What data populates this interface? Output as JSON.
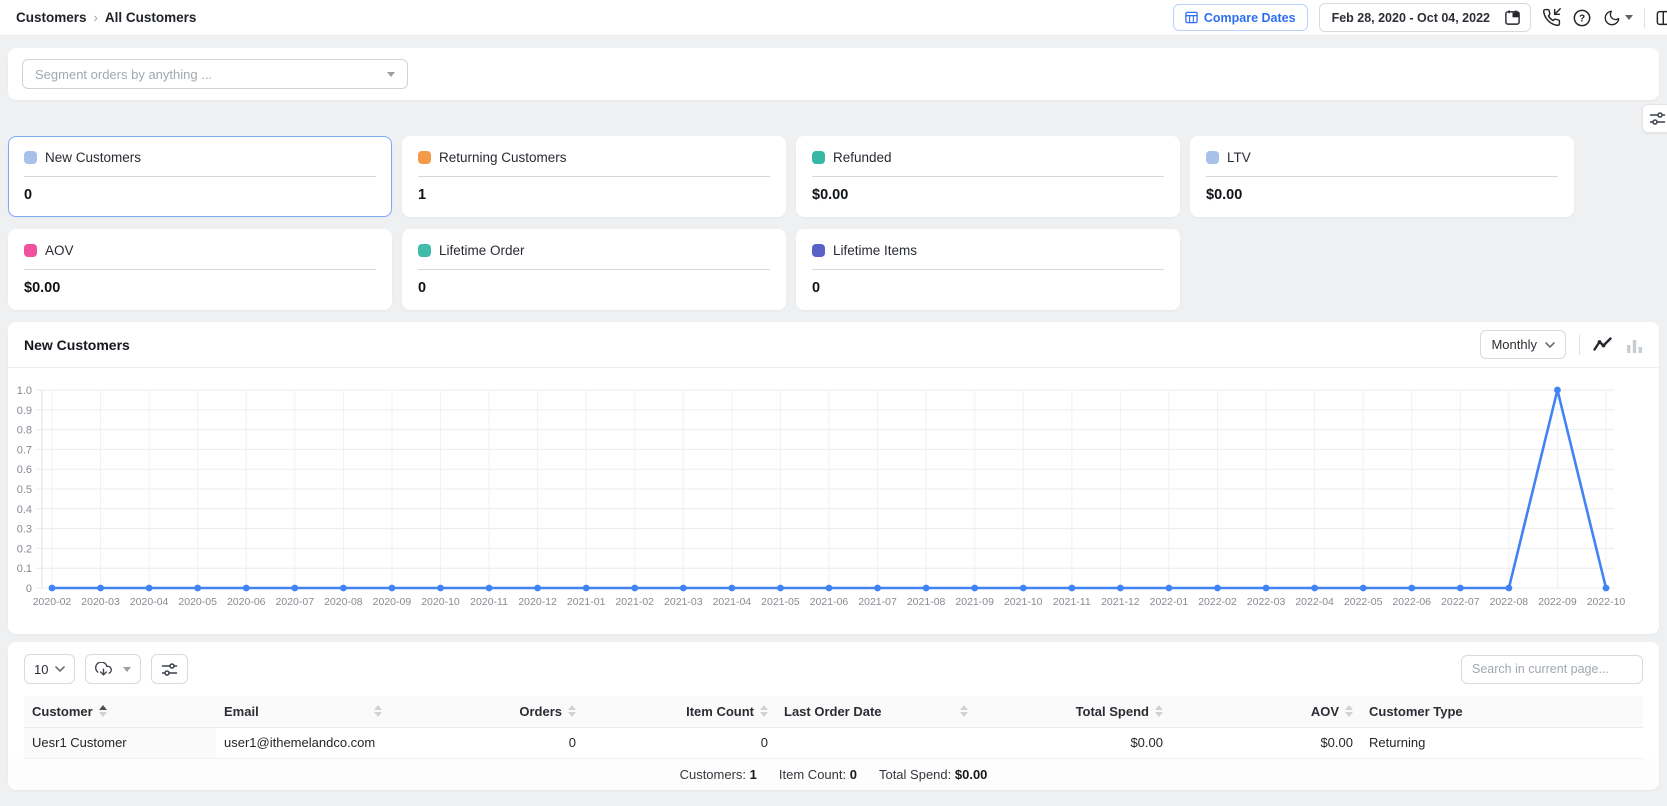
{
  "breadcrumb": {
    "items": [
      "Customers",
      "All Customers"
    ],
    "separator": "›"
  },
  "topbar": {
    "compare_dates_label": "Compare Dates",
    "date_range": "Feb 28, 2020 - Oct 04, 2022"
  },
  "segment": {
    "placeholder": "Segment orders by anything ..."
  },
  "stat_cards": [
    {
      "label": "New Customers",
      "value": "0",
      "color": "#a9c0ea",
      "selected": true
    },
    {
      "label": "Returning Customers",
      "value": "1",
      "color": "#f59a49",
      "selected": false
    },
    {
      "label": "Refunded",
      "value": "$0.00",
      "color": "#38b7a4",
      "selected": false
    },
    {
      "label": "LTV",
      "value": "$0.00",
      "color": "#a9c0ea",
      "selected": false
    },
    {
      "label": "AOV",
      "value": "$0.00",
      "color": "#f0509e",
      "selected": false
    },
    {
      "label": "Lifetime Order",
      "value": "0",
      "color": "#41bcab",
      "selected": false
    },
    {
      "label": "Lifetime Items",
      "value": "0",
      "color": "#5a61c9",
      "selected": false
    }
  ],
  "chart_section": {
    "title": "New Customers",
    "interval_selected": "Monthly"
  },
  "chart_data": {
    "type": "line",
    "title": "New Customers",
    "categories": [
      "2020-02",
      "2020-03",
      "2020-04",
      "2020-05",
      "2020-06",
      "2020-07",
      "2020-08",
      "2020-09",
      "2020-10",
      "2020-11",
      "2020-12",
      "2021-01",
      "2021-02",
      "2021-03",
      "2021-04",
      "2021-05",
      "2021-06",
      "2021-07",
      "2021-08",
      "2021-09",
      "2021-10",
      "2021-11",
      "2021-12",
      "2022-01",
      "2022-02",
      "2022-03",
      "2022-04",
      "2022-05",
      "2022-06",
      "2022-07",
      "2022-08",
      "2022-09",
      "2022-10"
    ],
    "values": [
      0,
      0,
      0,
      0,
      0,
      0,
      0,
      0,
      0,
      0,
      0,
      0,
      0,
      0,
      0,
      0,
      0,
      0,
      0,
      0,
      0,
      0,
      0,
      0,
      0,
      0,
      0,
      0,
      0,
      0,
      0,
      1,
      0
    ],
    "xlabel": "",
    "ylabel": "",
    "ylim": [
      0,
      1.0
    ],
    "yticks": [
      0,
      0.1,
      0.2,
      0.3,
      0.4,
      0.5,
      0.6,
      0.7,
      0.8,
      0.9,
      1.0
    ],
    "line_color": "#4183f4",
    "grid": true,
    "legend": false
  },
  "table": {
    "page_size": "10",
    "search_placeholder": "Search in current page...",
    "columns": [
      {
        "label": "Customer",
        "sort": "asc",
        "align": "left"
      },
      {
        "label": "Email",
        "sort": "none",
        "align": "left"
      },
      {
        "label": "Orders",
        "sort": "none",
        "align": "right"
      },
      {
        "label": "Item Count",
        "sort": "none",
        "align": "right"
      },
      {
        "label": "Last Order Date",
        "sort": "none",
        "align": "left"
      },
      {
        "label": "Total Spend",
        "sort": "none",
        "align": "right"
      },
      {
        "label": "AOV",
        "sort": "none",
        "align": "right"
      },
      {
        "label": "Customer Type",
        "sort": null,
        "align": "left"
      }
    ],
    "rows": [
      [
        "Uesr1 Customer",
        "user1@ithemelandco.com",
        "0",
        "0",
        "",
        "$0.00",
        "$0.00",
        "Returning"
      ]
    ],
    "summary": [
      {
        "label": "Customers:",
        "value": "1"
      },
      {
        "label": "Item Count:",
        "value": "0"
      },
      {
        "label": "Total Spend:",
        "value": "$0.00"
      }
    ]
  }
}
